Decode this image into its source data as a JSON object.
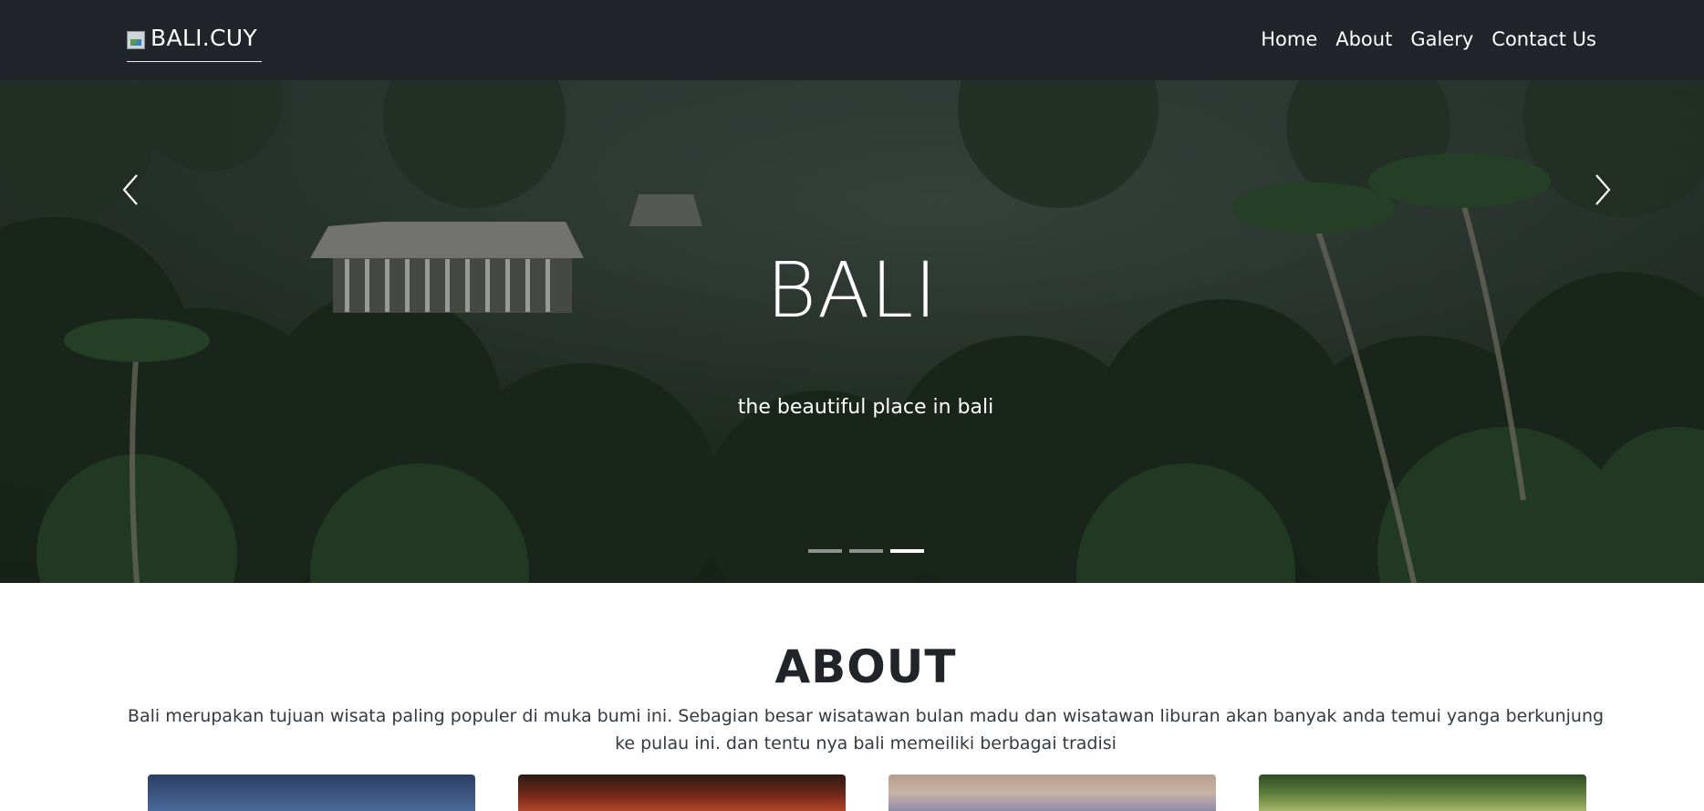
{
  "navbar": {
    "brand": "BALI.CUY",
    "links": [
      "Home",
      "About",
      "Galery",
      "Contact Us"
    ]
  },
  "hero": {
    "title": "BALI",
    "subtitle": "the beautiful place in bali",
    "slide_count": 3,
    "active_slide": 3
  },
  "about": {
    "title": "ABOUT",
    "text": "Bali merupakan tujuan wisata paling populer di muka bumi ini. Sebagian besar wisatawan bulan madu dan wisatawan liburan akan banyak anda temui yanga berkunjung ke pulau ini. dan tentu nya bali memeiliki berbagai tradisi"
  },
  "icons": {
    "prev": "chevron-left-icon",
    "next": "chevron-right-icon",
    "logo": "broken-image-icon"
  },
  "colors": {
    "navbar_bg": "#212529",
    "text_dark": "#212529",
    "white": "#ffffff"
  }
}
